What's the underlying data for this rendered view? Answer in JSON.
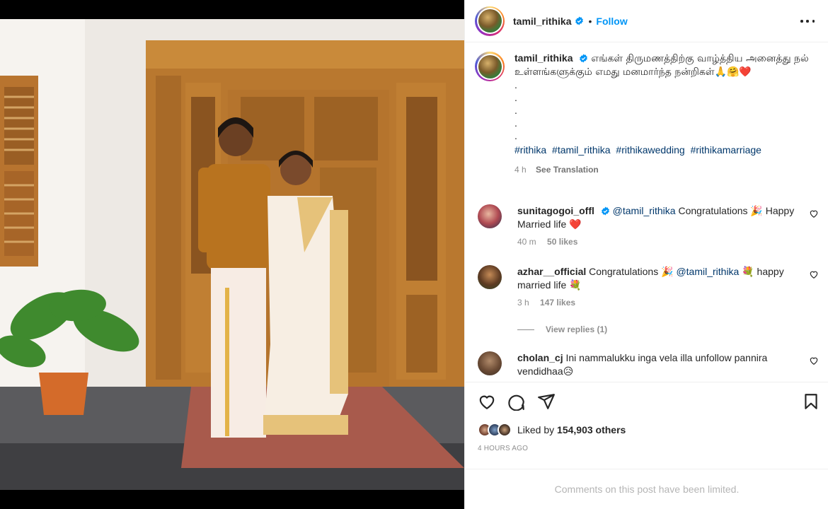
{
  "post": {
    "username": "tamil_rithika",
    "follow_label": "Follow",
    "separator": "•",
    "caption": "எங்கள் திருமணத்திற்கு வாழ்த்திய அனைத்து நல் உள்ளங்களுக்கும் எமது மனமார்ந்த நன்றிகள்🙏🤗❤️",
    "caption_dots": [
      ".",
      ".",
      ".",
      ".",
      "."
    ],
    "hashtags": [
      "#rithika",
      "#tamil_rithika",
      "#rithikawedding",
      "#rithikamarriage"
    ],
    "caption_time": "4 h",
    "see_translation": "See Translation"
  },
  "comments": [
    {
      "username": "sunitagogoi_offl",
      "mention": "@tamil_rithika",
      "text": "Congratulations 🎉 Happy Married life ❤️",
      "time": "40 m",
      "likes": "50 likes"
    },
    {
      "username": "azhar__official",
      "text_before": "Congratulations 🎉",
      "mention": "@tamil_rithika",
      "text_after": "💐 happy married life 💐",
      "time": "3 h",
      "likes": "147 likes",
      "view_replies": "View replies (1)"
    },
    {
      "username": "cholan_cj",
      "text": "Ini nammalukku inga vela illa unfollow pannira vendidhaa😥"
    }
  ],
  "likes": {
    "prefix": "Liked by",
    "count": "154,903 others"
  },
  "timestamp": "4 HOURS AGO",
  "comments_limited": "Comments on this post have been limited.",
  "colors": {
    "link": "#0095f6",
    "hashtag": "#00376b",
    "muted": "#8e8e8e"
  },
  "icons": [
    "verified-icon",
    "more-icon",
    "heart-icon",
    "comment-icon",
    "share-icon",
    "save-icon"
  ]
}
